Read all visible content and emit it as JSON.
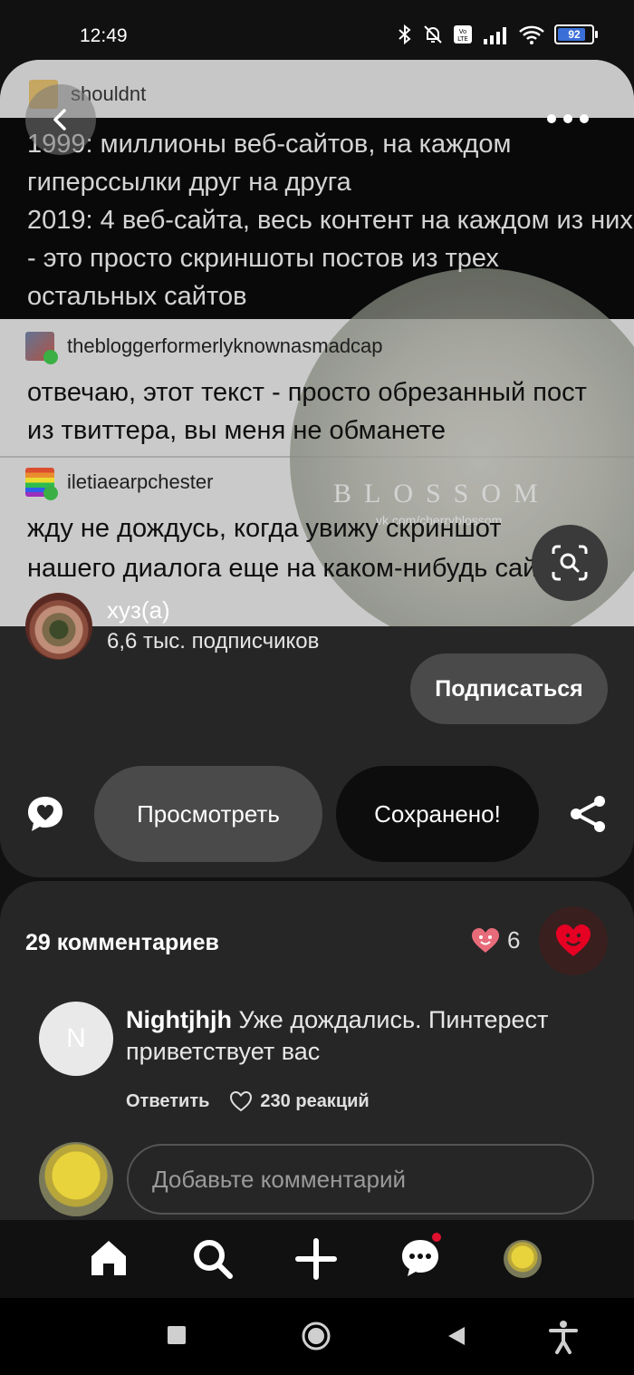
{
  "status": {
    "time": "12:49",
    "battery": "92"
  },
  "pin": {
    "post1_user": "shouldnt",
    "post1_text": "1999: миллионы веб-сайтов, на каждом гиперссылки друг на друга\n2019: 4 веб-сайта, весь контент на каждом из них - это просто скриншоты постов из трех остальных сайтов",
    "post2_user": "thebloggerformerlyknownasmadcap",
    "post2_text": "отвечаю, этот текст - просто обрезанный пост из твиттера, вы меня не обманете",
    "post3_user": "iletiaearpchester",
    "post3_text": "жду не дождусь, когда увижу скриншот нашего диалога еще на каком-нибудь сайте",
    "watermark": "BLOSSOM",
    "watermark_url": "vk.com/cherryblossom"
  },
  "creator": {
    "name": "хуз(а)",
    "followers": "6,6 тыс. подписчиков",
    "follow_label": "Подписаться"
  },
  "actions": {
    "view_label": "Просмотреть",
    "saved_label": "Сохранено!"
  },
  "comments": {
    "count_label": "29 комментариев",
    "reactions": "6",
    "items": [
      {
        "avatar_letter": "N",
        "author": "Nightjhjh",
        "text": "Уже дождались. Пинтерест приветствует вас",
        "reply_label": "Ответить",
        "reactions_label": "230 реакций"
      }
    ],
    "input_placeholder": "Добавьте комментарий"
  },
  "icons": {
    "back": "chevron-left-icon",
    "more": "more-icon",
    "lens": "visual-search-icon",
    "chat": "comment-bubble-icon",
    "share": "share-icon",
    "heart": "heart-icon",
    "home": "home-icon",
    "search": "search-icon",
    "add": "plus-icon",
    "messages": "messages-icon"
  },
  "colors": {
    "heart": "#e60023",
    "notification": "#e0102f",
    "battery": "#3a6fd8"
  }
}
